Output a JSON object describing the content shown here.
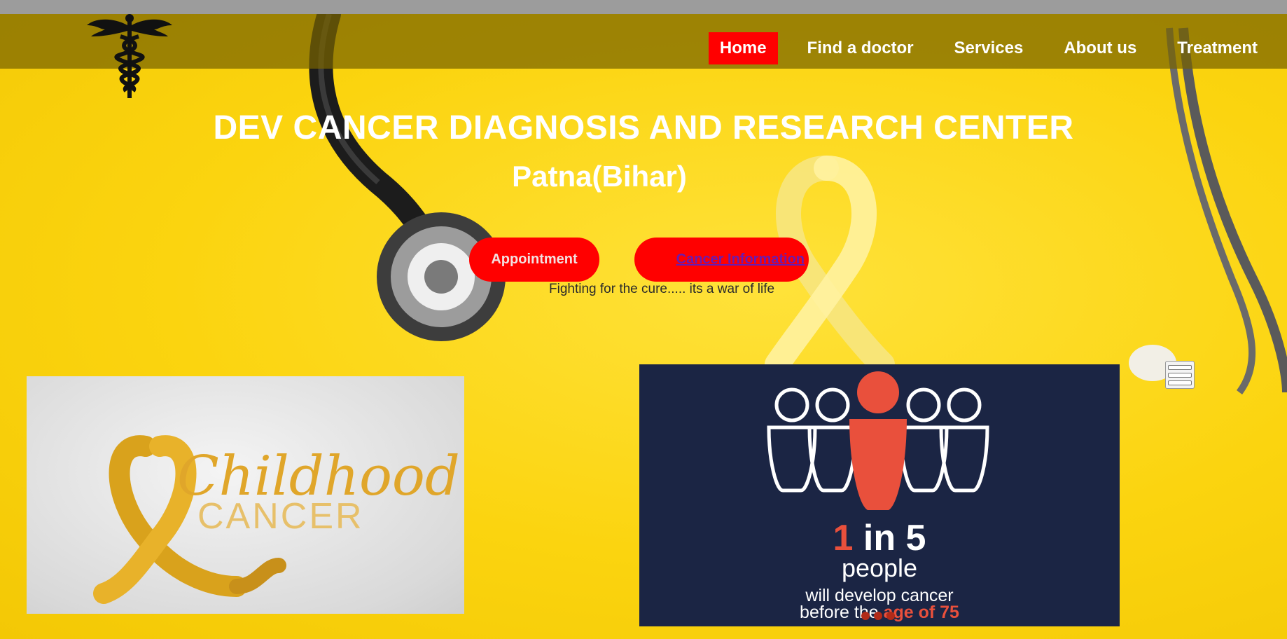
{
  "nav": {
    "items": [
      {
        "label": "Home",
        "active": true
      },
      {
        "label": "Find a doctor",
        "active": false
      },
      {
        "label": "Services",
        "active": false
      },
      {
        "label": "About us",
        "active": false
      },
      {
        "label": "Treatment",
        "active": false
      }
    ],
    "active_color": "#ff0000"
  },
  "hero": {
    "title": "DEV CANCER DIAGNOSIS AND RESEARCH CENTER",
    "subtitle": "Patna(Bihar)",
    "appointment_label": "Appointment",
    "cancer_info_label": "Cancer Information",
    "tagline": "Fighting for the cure..... its a war of life"
  },
  "card_left": {
    "word1": "Childhood",
    "word2": "CANCER"
  },
  "card_right": {
    "stat_num1": "1",
    "stat_rest": " in 5",
    "people": "people",
    "line1": "will develop cancer",
    "line2_prefix": "before the ",
    "line2_highlight": "age of 75"
  },
  "icons": {
    "logo": "caduceus-logo",
    "menu": "hamburger-menu-icon"
  },
  "colors": {
    "background": "#f9d20c",
    "button": "#ff0000",
    "stat_accent": "#e9503c",
    "stat_bg": "#1b2544"
  }
}
